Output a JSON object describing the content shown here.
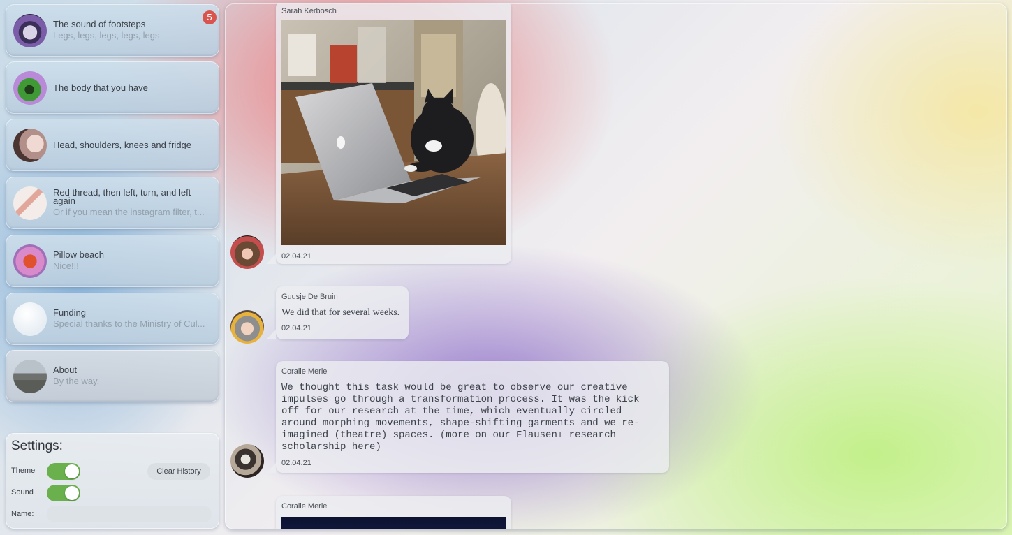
{
  "sidebar": {
    "chats": [
      {
        "title": "The sound of footsteps",
        "subtitle": "Legs, legs, legs, legs, legs",
        "badge": "5",
        "avatar_icon": "footsteps-avatar-icon"
      },
      {
        "title": "The body that you have",
        "subtitle": "",
        "avatar_icon": "body-avatar-icon"
      },
      {
        "title": "Head, shoulders, knees and fridge",
        "subtitle": "",
        "avatar_icon": "head-avatar-icon"
      },
      {
        "title": "Red thread, then left, turn, and left again",
        "subtitle": "Or if you mean the instagram filter, t...",
        "avatar_icon": "thread-avatar-icon"
      },
      {
        "title": "Pillow beach",
        "subtitle": "Nice!!!",
        "avatar_icon": "pillow-avatar-icon"
      },
      {
        "title": "Funding",
        "subtitle": "Special thanks to the Ministry of Cul...",
        "avatar_icon": "funding-avatar-icon"
      },
      {
        "title": "About",
        "subtitle": "By the way,",
        "avatar_icon": "about-avatar-icon"
      }
    ]
  },
  "settings": {
    "title": "Settings:",
    "theme_label": "Theme",
    "sound_label": "Sound",
    "name_label": "Name:",
    "clear_label": "Clear History",
    "theme_on": true,
    "sound_on": true,
    "name_value": ""
  },
  "messages": [
    {
      "sender": "Sarah Kerbosch",
      "type": "image",
      "media": "cat-typing-on-laptop",
      "date": "02.04.21"
    },
    {
      "sender": "Guusje De Bruin",
      "type": "text",
      "text": "We did that for several weeks.",
      "date": "02.04.21"
    },
    {
      "sender": "Coralie Merle",
      "type": "text",
      "lines": [
        "We thought this task would be great to observe our creative",
        "impulses go through a transformation process. It was the kick",
        "off for our research at the time, which eventually circled",
        "around morphing movements, shape-shifting garments and we re-",
        "imagined (theatre) spaces. (more on our Flausen+ research",
        "scholarship "
      ],
      "link_text": "here",
      "after_link": ")",
      "date": "02.04.21"
    },
    {
      "sender": "Coralie Merle",
      "type": "image",
      "media": "dark-stage-image"
    }
  ],
  "colors": {
    "badge": "#d9534f",
    "toggle_on": "#6ab04c",
    "bubble": "#ecedf0"
  }
}
